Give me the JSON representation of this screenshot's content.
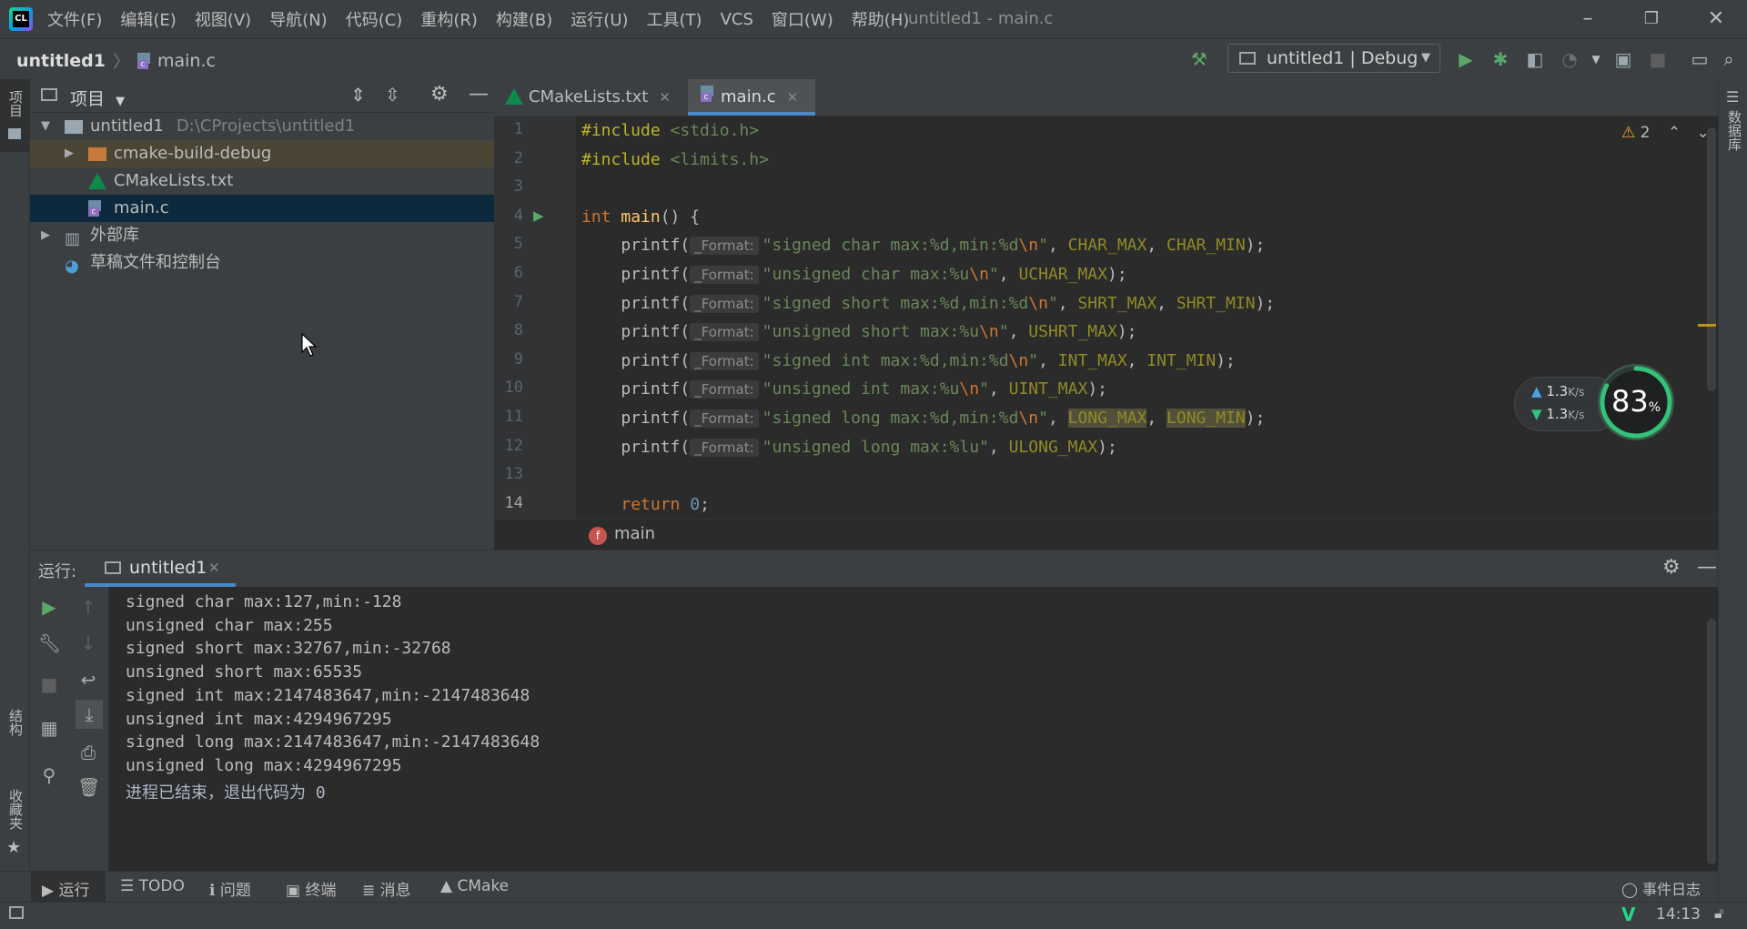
{
  "app": {
    "logo_text": "CL",
    "window_title": "untitled1 - main.c"
  },
  "menu": [
    "文件(F)",
    "编辑(E)",
    "视图(V)",
    "导航(N)",
    "代码(C)",
    "重构(R)",
    "构建(B)",
    "运行(U)",
    "工具(T)",
    "VCS",
    "窗口(W)",
    "帮助(H)"
  ],
  "nav": {
    "project": "untitled1",
    "file": "main.c",
    "run_config": "untitled1 | Debug"
  },
  "left_stripe": {
    "project": "项目",
    "structure": "结构",
    "favorites": "收藏夹"
  },
  "right_stripe": {
    "database": "数据库"
  },
  "project_panel": {
    "title": "项目",
    "root_name": "untitled1",
    "root_path": "D:\\CProjects\\untitled1",
    "items": [
      {
        "label": "cmake-build-debug"
      },
      {
        "label": "CMakeLists.txt"
      },
      {
        "label": "main.c"
      }
    ],
    "external_libs": "外部库",
    "scratches": "草稿文件和控制台"
  },
  "editor": {
    "tabs": [
      {
        "label": "CMakeLists.txt"
      },
      {
        "label": "main.c"
      }
    ],
    "warning_count": "2",
    "hint_label": "_Format:",
    "line_numbers": [
      "1",
      "2",
      "3",
      "4",
      "5",
      "6",
      "7",
      "8",
      "9",
      "10",
      "11",
      "12",
      "13",
      "14"
    ],
    "breadcrumb_fn_icon": "f",
    "breadcrumb_fn": "main",
    "lines": [
      {
        "type": "include",
        "directive": "#include",
        "header": "<stdio.h>"
      },
      {
        "type": "include",
        "directive": "#include",
        "header": "<limits.h>"
      },
      {
        "type": "blank"
      },
      {
        "type": "main",
        "kw": "int",
        "fn": "main",
        "rest": "() {"
      },
      {
        "type": "printf",
        "fmt": "signed char max:%d,min:%d",
        "esc": "\\n",
        "args": [
          "CHAR_MAX",
          "CHAR_MIN"
        ]
      },
      {
        "type": "printf",
        "fmt": "unsigned char max:%u",
        "esc": "\\n",
        "args": [
          "UCHAR_MAX"
        ]
      },
      {
        "type": "printf",
        "fmt": "signed short max:%d,min:%d",
        "esc": "\\n",
        "args": [
          "SHRT_MAX",
          "SHRT_MIN"
        ]
      },
      {
        "type": "printf",
        "fmt": "unsigned short max:%u",
        "esc": "\\n",
        "args": [
          "USHRT_MAX"
        ]
      },
      {
        "type": "printf",
        "fmt": "signed int max:%d,min:%d",
        "esc": "\\n",
        "args": [
          "INT_MAX",
          "INT_MIN"
        ]
      },
      {
        "type": "printf",
        "fmt": "unsigned int max:%u",
        "esc": "\\n",
        "args": [
          "UINT_MAX"
        ]
      },
      {
        "type": "printf",
        "fmt": "signed long max:%d,min:%d",
        "esc": "\\n",
        "args": [
          "LONG_MAX",
          "LONG_MIN"
        ],
        "highlight": true
      },
      {
        "type": "printf",
        "fmt": "unsigned long max:%lu",
        "esc": "",
        "args": [
          "ULONG_MAX"
        ]
      },
      {
        "type": "blank"
      },
      {
        "type": "return",
        "kw": "return",
        "value": "0"
      }
    ]
  },
  "net_widget": {
    "upload": "1.3",
    "download": "1.3",
    "unit": "K/s",
    "percent": "83",
    "percent_sign": "%"
  },
  "run_panel": {
    "label": "运行:",
    "tab": "untitled1",
    "output": [
      "signed char max:127,min:-128",
      "unsigned char max:255",
      "signed short max:32767,min:-32768",
      "unsigned short max:65535",
      "signed int max:2147483647,min:-2147483648",
      "unsigned int max:4294967295",
      "signed long max:2147483647,min:-2147483648",
      "unsigned long max:4294967295",
      "进程已结束，退出代码为 0"
    ]
  },
  "bottom_tabs": [
    "运行",
    "TODO",
    "问题",
    "终端",
    "消息",
    "CMake"
  ],
  "event_log": "事件日志",
  "status": {
    "time": "14:13"
  },
  "colors": {
    "accent": "#4a88c7",
    "run_green": "#59a869",
    "gauge": "#34c27a"
  }
}
